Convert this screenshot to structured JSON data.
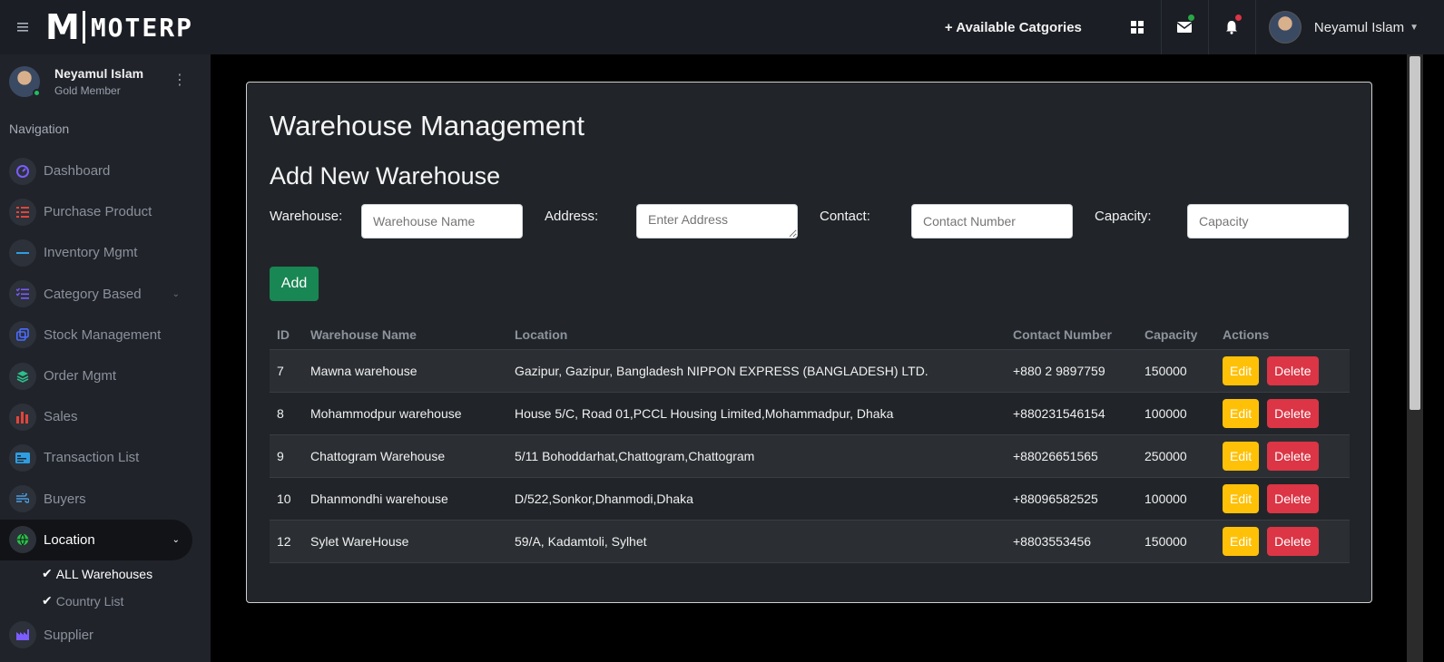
{
  "topbar": {
    "logo_m": "M",
    "logo_rest": "MOTERP",
    "available_categories": "+ Available Catgories",
    "user_name": "Neyamul Islam",
    "colors": {
      "mail_dot": "#28a745",
      "bell_dot": "#dc3545"
    }
  },
  "sidebar": {
    "user_name": "Neyamul Islam",
    "user_role": "Gold Member",
    "nav_title": "Navigation",
    "items": [
      {
        "label": "Dashboard",
        "icon": "gauge-icon",
        "color": "#7b5cff"
      },
      {
        "label": "Purchase Product",
        "icon": "list-icon",
        "color": "#e0453b"
      },
      {
        "label": "Inventory Mgmt",
        "icon": "minus-icon",
        "color": "#2f9de0"
      },
      {
        "label": "Category Based",
        "icon": "checklist-icon",
        "color": "#7b5cff"
      },
      {
        "label": "Stock Management",
        "icon": "copy-icon",
        "color": "#4b6cff"
      },
      {
        "label": "Order Mgmt",
        "icon": "layers-icon",
        "color": "#2bbf8a"
      },
      {
        "label": "Sales",
        "icon": "bar-chart-icon",
        "color": "#e0453b"
      },
      {
        "label": "Transaction List",
        "icon": "id-card-icon",
        "color": "#2f9de0"
      },
      {
        "label": "Buyers",
        "icon": "wind-icon",
        "color": "#4b9ce0"
      },
      {
        "label": "Location",
        "icon": "globe-icon",
        "color": "#2bbf4a"
      },
      {
        "label": "Supplier",
        "icon": "factory-icon",
        "color": "#7b5cff"
      }
    ],
    "sub_items": [
      {
        "label": "ALL Warehouses"
      },
      {
        "label": "Country List"
      }
    ]
  },
  "main": {
    "title": "Warehouse Management",
    "subtitle": "Add New Warehouse",
    "form": {
      "warehouse_label": "Warehouse:",
      "warehouse_placeholder": "Warehouse Name",
      "address_label": "Address:",
      "address_placeholder": "Enter Address",
      "contact_label": "Contact:",
      "contact_placeholder": "Contact Number",
      "capacity_label": "Capacity:",
      "capacity_placeholder": "Capacity",
      "add_button": "Add"
    },
    "table": {
      "headers": [
        "ID",
        "Warehouse Name",
        "Location",
        "Contact Number",
        "Capacity",
        "Actions"
      ],
      "edit_label": "Edit",
      "delete_label": "Delete",
      "rows": [
        {
          "id": "7",
          "name": "Mawna warehouse",
          "location": "Gazipur, Gazipur, Bangladesh NIPPON EXPRESS (BANGLADESH) LTD.",
          "contact": "+880 2 9897759",
          "capacity": "150000"
        },
        {
          "id": "8",
          "name": "Mohammodpur warehouse",
          "location": "House 5/C, Road 01,PCCL Housing Limited,Mohammadpur, Dhaka",
          "contact": "+880231546154",
          "capacity": "100000"
        },
        {
          "id": "9",
          "name": "Chattogram Warehouse",
          "location": "5/11 Bohoddarhat,Chattogram,Chattogram",
          "contact": "+88026651565",
          "capacity": "250000"
        },
        {
          "id": "10",
          "name": "Dhanmondhi warehouse",
          "location": "D/522,Sonkor,Dhanmodi,Dhaka",
          "contact": "+88096582525",
          "capacity": "100000"
        },
        {
          "id": "12",
          "name": "Sylet WareHouse",
          "location": "59/A, Kadamtoli, Sylhet",
          "contact": "+8803553456",
          "capacity": "150000"
        }
      ]
    }
  }
}
